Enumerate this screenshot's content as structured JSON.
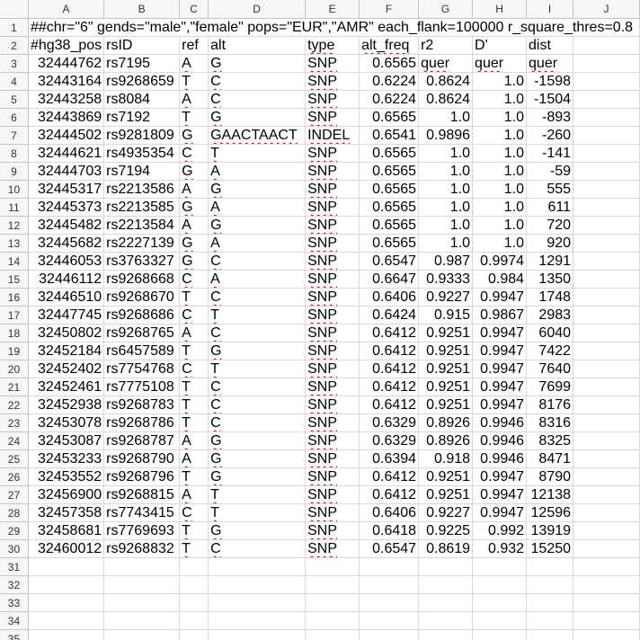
{
  "columns": [
    "A",
    "B",
    "C",
    "D",
    "E",
    "F",
    "G",
    "H",
    "I",
    "J"
  ],
  "header_line": "##chr=\"6\" gends=\"male\",\"female\" pops=\"EUR\",\"AMR\" each_flank=100000 r_square_thres=0.8",
  "headers": [
    "#hg38_pos",
    "rsID",
    "ref",
    "alt",
    "type",
    "alt_freq",
    "r2",
    "D'",
    "dist"
  ],
  "rows": [
    [
      "32444762",
      "rs7195",
      "A",
      "G",
      "SNP",
      "0.6565",
      "quer",
      "quer",
      "quer"
    ],
    [
      "32443164",
      "rs9268659",
      "T",
      "C",
      "SNP",
      "0.6224",
      "0.8624",
      "1.0",
      "-1598"
    ],
    [
      "32443258",
      "rs8084",
      "A",
      "C",
      "SNP",
      "0.6224",
      "0.8624",
      "1.0",
      "-1504"
    ],
    [
      "32443869",
      "rs7192",
      "T",
      "G",
      "SNP",
      "0.6565",
      "1.0",
      "1.0",
      "-893"
    ],
    [
      "32444502",
      "rs9281809",
      "G",
      "GAACTAACT",
      "INDEL",
      "0.6541",
      "0.9896",
      "1.0",
      "-260"
    ],
    [
      "32444621",
      "rs4935354",
      "C",
      "T",
      "SNP",
      "0.6565",
      "1.0",
      "1.0",
      "-141"
    ],
    [
      "32444703",
      "rs7194",
      "G",
      "A",
      "SNP",
      "0.6565",
      "1.0",
      "1.0",
      "-59"
    ],
    [
      "32445317",
      "rs2213586",
      "A",
      "G",
      "SNP",
      "0.6565",
      "1.0",
      "1.0",
      "555"
    ],
    [
      "32445373",
      "rs2213585",
      "G",
      "A",
      "SNP",
      "0.6565",
      "1.0",
      "1.0",
      "611"
    ],
    [
      "32445482",
      "rs2213584",
      "A",
      "G",
      "SNP",
      "0.6565",
      "1.0",
      "1.0",
      "720"
    ],
    [
      "32445682",
      "rs2227139",
      "G",
      "A",
      "SNP",
      "0.6565",
      "1.0",
      "1.0",
      "920"
    ],
    [
      "32446053",
      "rs3763327",
      "G",
      "C",
      "SNP",
      "0.6547",
      "0.987",
      "0.9974",
      "1291"
    ],
    [
      "32446112",
      "rs9268668",
      "C",
      "A",
      "SNP",
      "0.6647",
      "0.9333",
      "0.984",
      "1350"
    ],
    [
      "32446510",
      "rs9268670",
      "T",
      "C",
      "SNP",
      "0.6406",
      "0.9227",
      "0.9947",
      "1748"
    ],
    [
      "32447745",
      "rs9268686",
      "C",
      "T",
      "SNP",
      "0.6424",
      "0.915",
      "0.9867",
      "2983"
    ],
    [
      "32450802",
      "rs9268765",
      "A",
      "C",
      "SNP",
      "0.6412",
      "0.9251",
      "0.9947",
      "6040"
    ],
    [
      "32452184",
      "rs6457589",
      "T",
      "G",
      "SNP",
      "0.6412",
      "0.9251",
      "0.9947",
      "7422"
    ],
    [
      "32452402",
      "rs7754768",
      "C",
      "T",
      "SNP",
      "0.6412",
      "0.9251",
      "0.9947",
      "7640"
    ],
    [
      "32452461",
      "rs7775108",
      "T",
      "C",
      "SNP",
      "0.6412",
      "0.9251",
      "0.9947",
      "7699"
    ],
    [
      "32452938",
      "rs9268783",
      "T",
      "C",
      "SNP",
      "0.6412",
      "0.9251",
      "0.9947",
      "8176"
    ],
    [
      "32453078",
      "rs9268786",
      "T",
      "C",
      "SNP",
      "0.6329",
      "0.8926",
      "0.9946",
      "8316"
    ],
    [
      "32453087",
      "rs9268787",
      "A",
      "G",
      "SNP",
      "0.6329",
      "0.8926",
      "0.9946",
      "8325"
    ],
    [
      "32453233",
      "rs9268790",
      "A",
      "G",
      "SNP",
      "0.6394",
      "0.918",
      "0.9946",
      "8471"
    ],
    [
      "32453552",
      "rs9268796",
      "T",
      "G",
      "SNP",
      "0.6412",
      "0.9251",
      "0.9947",
      "8790"
    ],
    [
      "32456900",
      "rs9268815",
      "A",
      "T",
      "SNP",
      "0.6412",
      "0.9251",
      "0.9947",
      "12138"
    ],
    [
      "32457358",
      "rs7743415",
      "C",
      "T",
      "SNP",
      "0.6406",
      "0.9227",
      "0.9947",
      "12596"
    ],
    [
      "32458681",
      "rs7769693",
      "T",
      "G",
      "SNP",
      "0.6418",
      "0.9225",
      "0.992",
      "13919"
    ],
    [
      "32460012",
      "rs9268832",
      "T",
      "C",
      "SNP",
      "0.6547",
      "0.8619",
      "0.932",
      "15250"
    ]
  ],
  "row_numbers": [
    1,
    2,
    3,
    4,
    5,
    6,
    7,
    8,
    9,
    10,
    11,
    12,
    13,
    14,
    15,
    16,
    17,
    18,
    19,
    20,
    21,
    22,
    23,
    24,
    25,
    26,
    27,
    28,
    29,
    30,
    31,
    32,
    33,
    34,
    35
  ]
}
